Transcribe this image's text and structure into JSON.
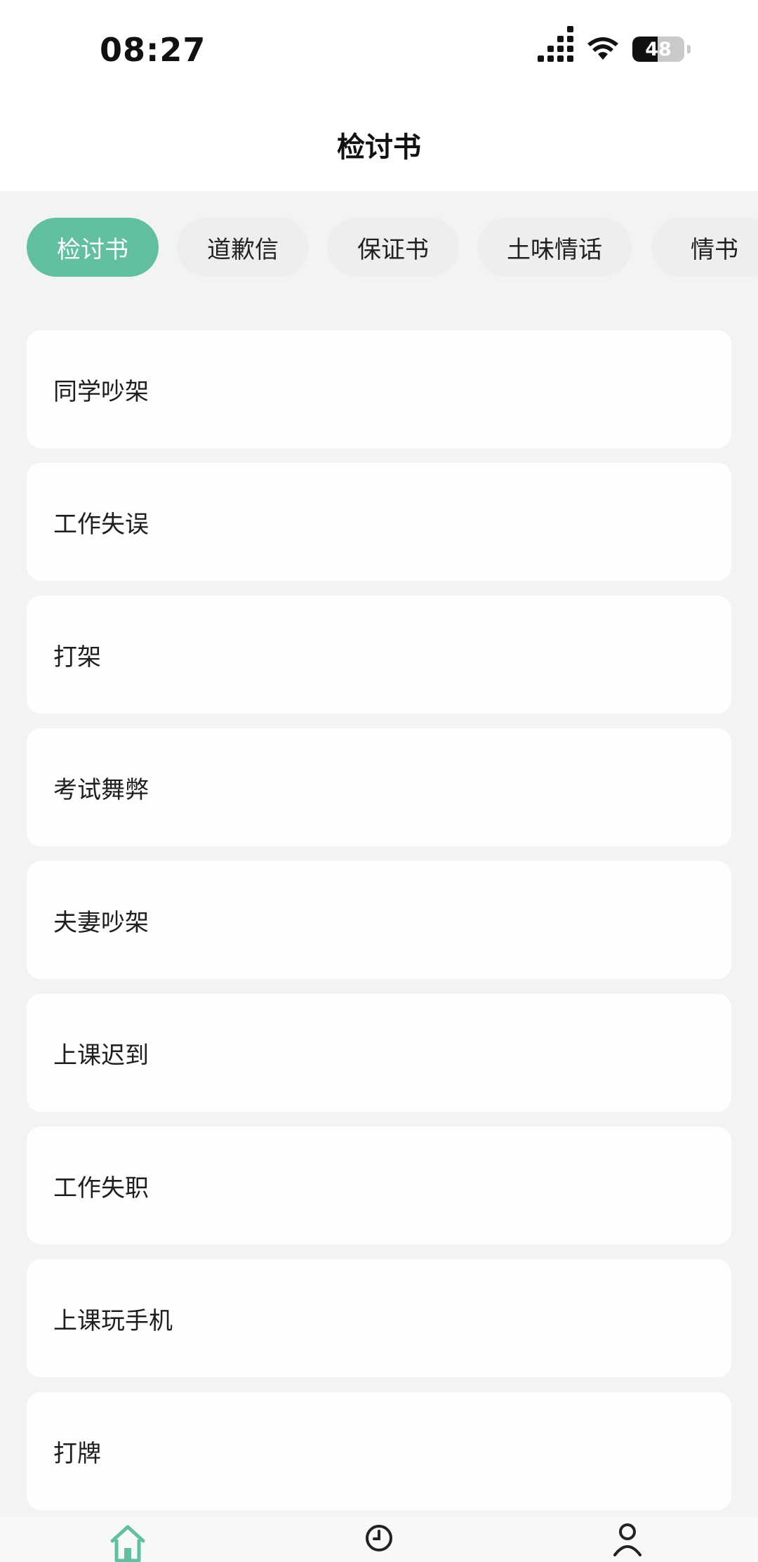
{
  "status_bar": {
    "time": "08:27",
    "battery": "48"
  },
  "header": {
    "title": "检讨书"
  },
  "tabs": [
    {
      "label": "检讨书",
      "active": true
    },
    {
      "label": "道歉信",
      "active": false
    },
    {
      "label": "保证书",
      "active": false
    },
    {
      "label": "土味情话",
      "active": false
    },
    {
      "label": "情书",
      "active": false
    }
  ],
  "items": [
    {
      "label": "同学吵架"
    },
    {
      "label": "工作失误"
    },
    {
      "label": "打架"
    },
    {
      "label": "考试舞弊"
    },
    {
      "label": "夫妻吵架"
    },
    {
      "label": "上课迟到"
    },
    {
      "label": "工作失职"
    },
    {
      "label": "上课玩手机"
    },
    {
      "label": "打牌"
    }
  ],
  "bottom_nav": {
    "icons": [
      "home-icon",
      "clock-icon",
      "user-icon"
    ],
    "accent": "#62bfa1"
  },
  "colors": {
    "accent": "#62bfa1",
    "background": "#f2f3f5"
  }
}
